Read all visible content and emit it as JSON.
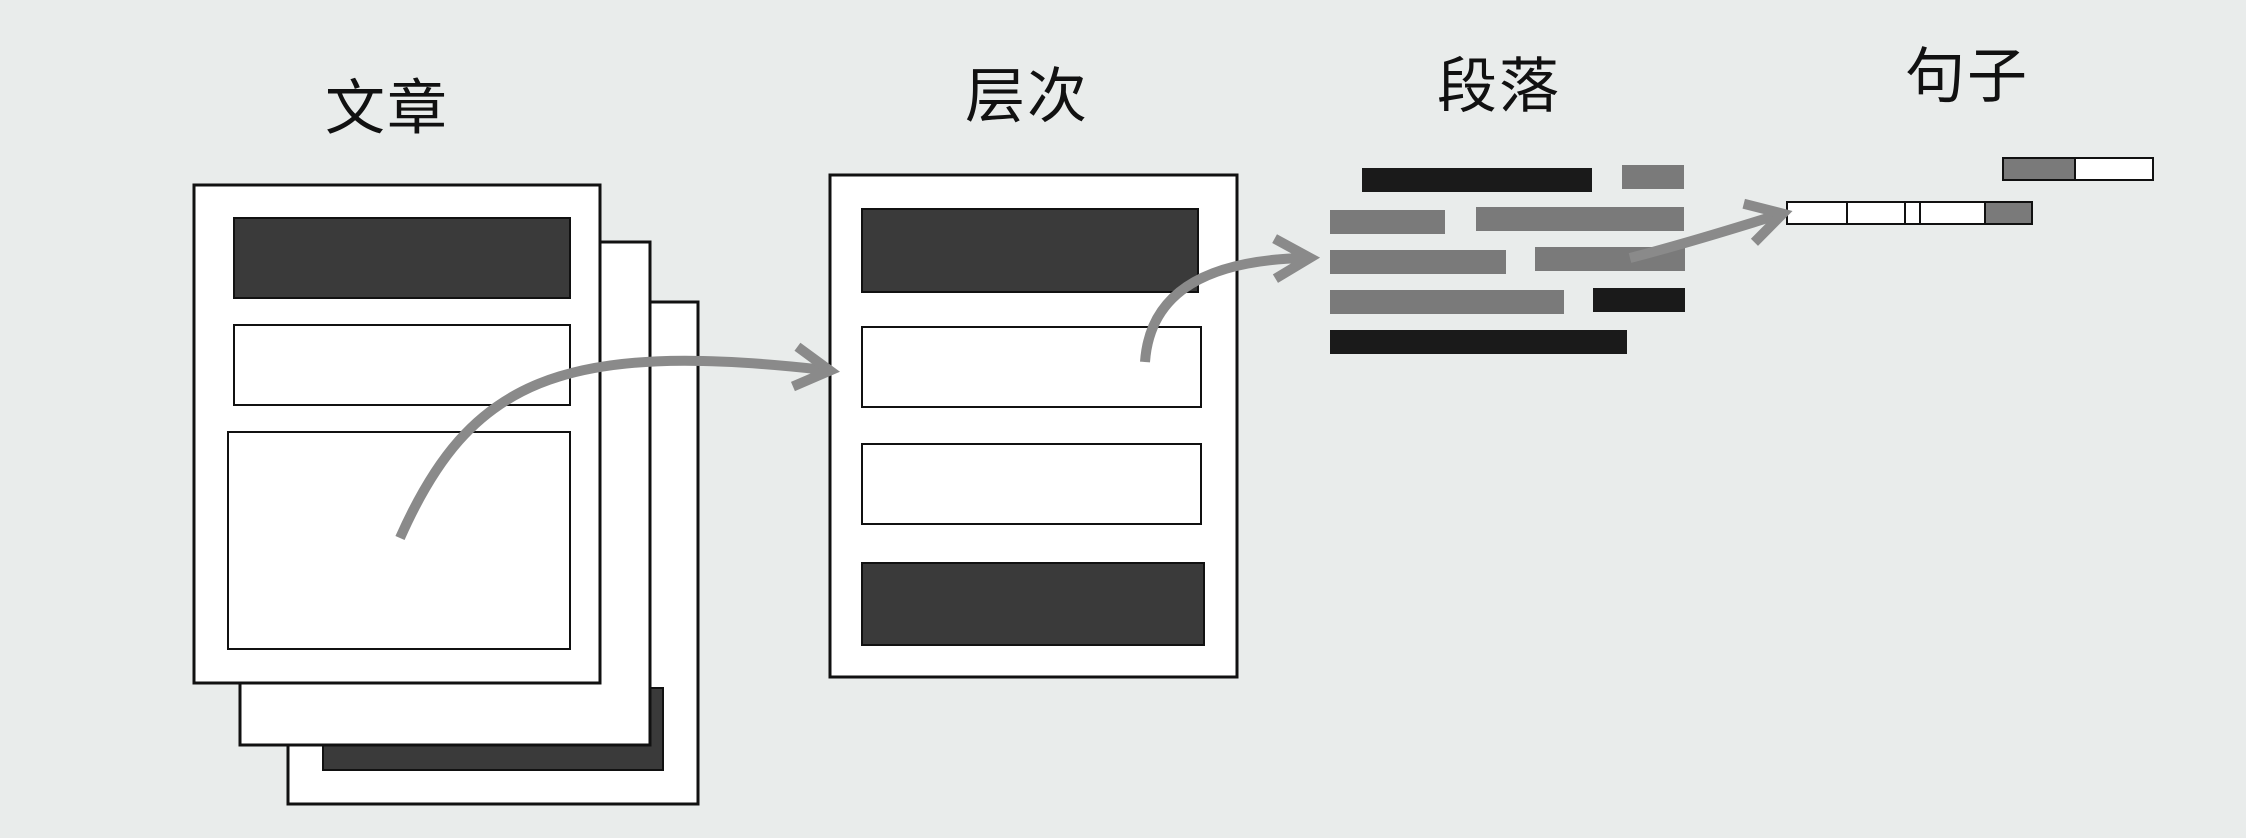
{
  "labels": {
    "article": "文章",
    "hierarchy": "层次",
    "paragraph": "段落",
    "sentence": "句子"
  },
  "colors": {
    "background": "#e9eceb",
    "page": "#ffffff",
    "outline": "#111111",
    "dark_block": "#3a3a3a",
    "gray_block": "#7a7a7a",
    "black_block": "#1a1a1a",
    "arrow": "#8a8a8a"
  }
}
